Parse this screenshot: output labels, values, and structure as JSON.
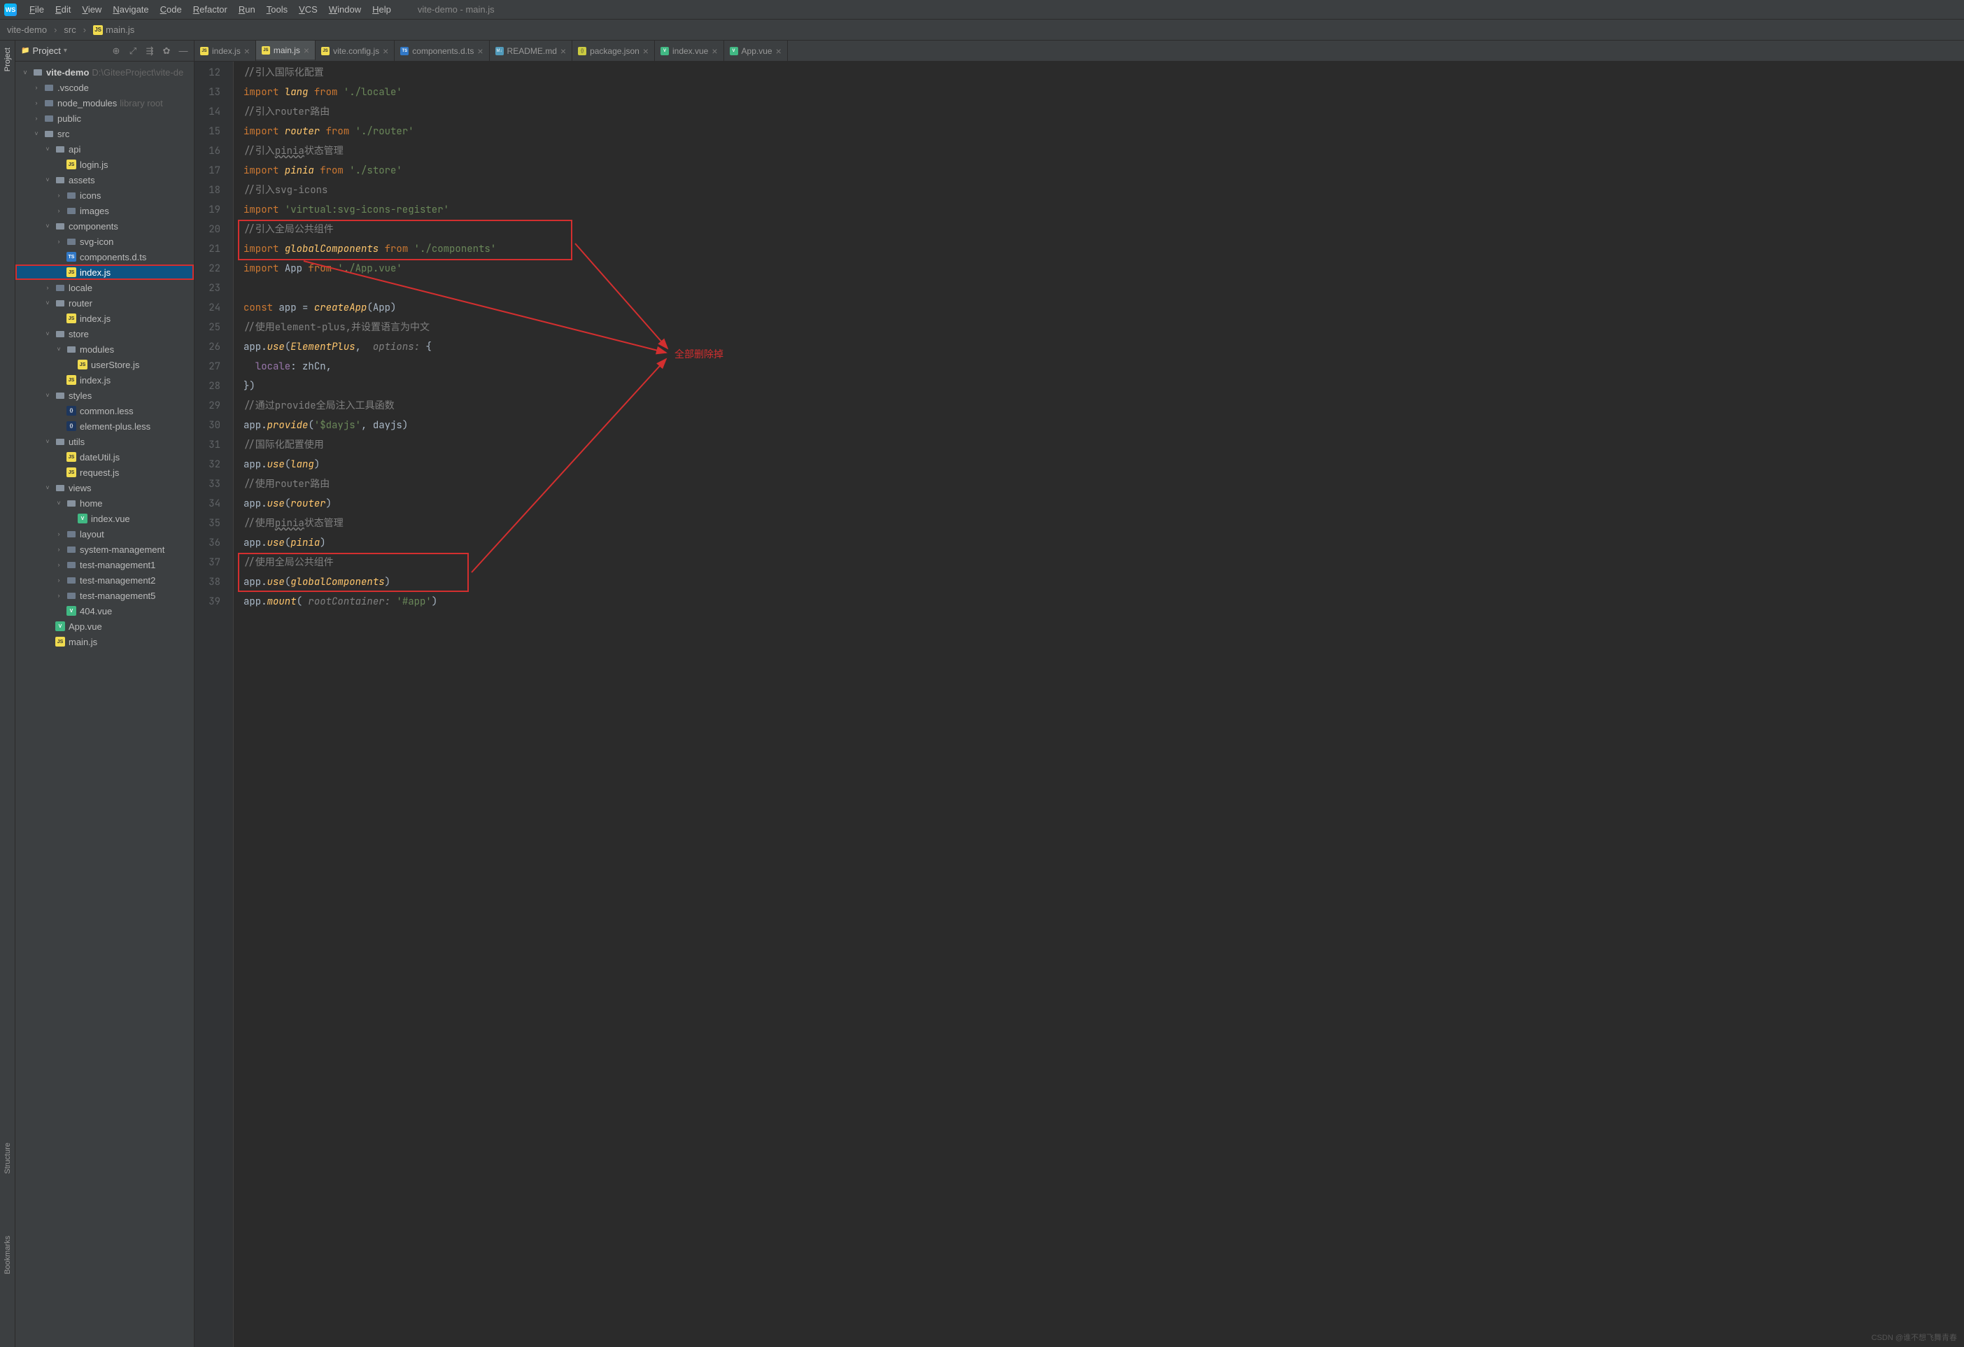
{
  "window": {
    "title": "vite-demo - main.js"
  },
  "menu": {
    "items": [
      "File",
      "Edit",
      "View",
      "Navigate",
      "Code",
      "Refactor",
      "Run",
      "Tools",
      "VCS",
      "Window",
      "Help"
    ]
  },
  "breadcrumb": {
    "root": "vite-demo",
    "mid": "src",
    "file": "main.js"
  },
  "pane": {
    "title": "Project",
    "toolbarIcons": [
      "target",
      "expand",
      "collapse",
      "gear",
      "minimize"
    ]
  },
  "gutterTabs": {
    "project": "Project",
    "structure": "Structure",
    "bookmarks": "Bookmarks"
  },
  "projectTree": {
    "root": {
      "name": "vite-demo",
      "path": "D:\\GiteeProject\\vite-de"
    },
    "items": [
      {
        "name": ".vscode",
        "indent": 1,
        "chev": ">",
        "ico": "folder"
      },
      {
        "name": "node_modules",
        "suffix": "library root",
        "indent": 1,
        "chev": ">",
        "ico": "folder"
      },
      {
        "name": "public",
        "indent": 1,
        "chev": ">",
        "ico": "folder"
      },
      {
        "name": "src",
        "indent": 1,
        "chev": "v",
        "ico": "folder-open"
      },
      {
        "name": "api",
        "indent": 2,
        "chev": "v",
        "ico": "folder-open"
      },
      {
        "name": "login.js",
        "indent": 3,
        "chev": "",
        "ico": "js"
      },
      {
        "name": "assets",
        "indent": 2,
        "chev": "v",
        "ico": "folder-open"
      },
      {
        "name": "icons",
        "indent": 3,
        "chev": ">",
        "ico": "folder"
      },
      {
        "name": "images",
        "indent": 3,
        "chev": ">",
        "ico": "folder"
      },
      {
        "name": "components",
        "indent": 2,
        "chev": "v",
        "ico": "folder-open"
      },
      {
        "name": "svg-icon",
        "indent": 3,
        "chev": ">",
        "ico": "folder"
      },
      {
        "name": "components.d.ts",
        "indent": 3,
        "chev": "",
        "ico": "ts"
      },
      {
        "name": "index.js",
        "indent": 3,
        "chev": "",
        "ico": "js",
        "selected": true
      },
      {
        "name": "locale",
        "indent": 2,
        "chev": ">",
        "ico": "folder"
      },
      {
        "name": "router",
        "indent": 2,
        "chev": "v",
        "ico": "folder-open"
      },
      {
        "name": "index.js",
        "indent": 3,
        "chev": "",
        "ico": "js"
      },
      {
        "name": "store",
        "indent": 2,
        "chev": "v",
        "ico": "folder-open"
      },
      {
        "name": "modules",
        "indent": 3,
        "chev": "v",
        "ico": "folder-open"
      },
      {
        "name": "userStore.js",
        "indent": 4,
        "chev": "",
        "ico": "js"
      },
      {
        "name": "index.js",
        "indent": 3,
        "chev": "",
        "ico": "js"
      },
      {
        "name": "styles",
        "indent": 2,
        "chev": "v",
        "ico": "folder-open"
      },
      {
        "name": "common.less",
        "indent": 3,
        "chev": "",
        "ico": "less"
      },
      {
        "name": "element-plus.less",
        "indent": 3,
        "chev": "",
        "ico": "less"
      },
      {
        "name": "utils",
        "indent": 2,
        "chev": "v",
        "ico": "folder-open"
      },
      {
        "name": "dateUtil.js",
        "indent": 3,
        "chev": "",
        "ico": "js"
      },
      {
        "name": "request.js",
        "indent": 3,
        "chev": "",
        "ico": "js"
      },
      {
        "name": "views",
        "indent": 2,
        "chev": "v",
        "ico": "folder-open"
      },
      {
        "name": "home",
        "indent": 3,
        "chev": "v",
        "ico": "folder-open"
      },
      {
        "name": "index.vue",
        "indent": 4,
        "chev": "",
        "ico": "vue"
      },
      {
        "name": "layout",
        "indent": 3,
        "chev": ">",
        "ico": "folder"
      },
      {
        "name": "system-management",
        "indent": 3,
        "chev": ">",
        "ico": "folder"
      },
      {
        "name": "test-management1",
        "indent": 3,
        "chev": ">",
        "ico": "folder"
      },
      {
        "name": "test-management2",
        "indent": 3,
        "chev": ">",
        "ico": "folder"
      },
      {
        "name": "test-management5",
        "indent": 3,
        "chev": ">",
        "ico": "folder"
      },
      {
        "name": "404.vue",
        "indent": 3,
        "chev": "",
        "ico": "vue"
      },
      {
        "name": "App.vue",
        "indent": 2,
        "chev": "",
        "ico": "vue"
      },
      {
        "name": "main.js",
        "indent": 2,
        "chev": "",
        "ico": "js"
      }
    ]
  },
  "tabs": [
    {
      "label": "index.js",
      "ico": "js"
    },
    {
      "label": "main.js",
      "ico": "js",
      "active": true
    },
    {
      "label": "vite.config.js",
      "ico": "js"
    },
    {
      "label": "components.d.ts",
      "ico": "ts"
    },
    {
      "label": "README.md",
      "ico": "md"
    },
    {
      "label": "package.json",
      "ico": "json"
    },
    {
      "label": "index.vue",
      "ico": "vue"
    },
    {
      "label": "App.vue",
      "ico": "vue"
    }
  ],
  "code": {
    "startLine": 12,
    "lines": [
      {
        "n": 12,
        "tokens": [
          [
            "com",
            "//引入国际化配置"
          ]
        ]
      },
      {
        "n": 13,
        "tokens": [
          [
            "kw",
            "import "
          ],
          [
            "func",
            "lang"
          ],
          [
            "kw",
            " from "
          ],
          [
            "str",
            "'./locale'"
          ]
        ]
      },
      {
        "n": 14,
        "tokens": [
          [
            "com",
            "//引入router路由"
          ]
        ]
      },
      {
        "n": 15,
        "tokens": [
          [
            "kw",
            "import "
          ],
          [
            "func",
            "router"
          ],
          [
            "kw",
            " from "
          ],
          [
            "str",
            "'./router'"
          ]
        ]
      },
      {
        "n": 16,
        "tokens": [
          [
            "com",
            "//引入"
          ],
          [
            "com-ul",
            "pinia"
          ],
          [
            "com",
            "状态管理"
          ]
        ]
      },
      {
        "n": 17,
        "tokens": [
          [
            "kw",
            "import "
          ],
          [
            "func",
            "pinia"
          ],
          [
            "kw",
            " from "
          ],
          [
            "str",
            "'./store'"
          ]
        ]
      },
      {
        "n": 18,
        "tokens": [
          [
            "com",
            "//引入svg-icons"
          ]
        ]
      },
      {
        "n": 19,
        "tokens": [
          [
            "kw",
            "import "
          ],
          [
            "str",
            "'virtual:svg-icons-register'"
          ]
        ]
      },
      {
        "n": 20,
        "tokens": [
          [
            "com",
            "//引入全局公共组件"
          ]
        ]
      },
      {
        "n": 21,
        "tokens": [
          [
            "kw",
            "import "
          ],
          [
            "func",
            "globalComponents"
          ],
          [
            "kw",
            " from "
          ],
          [
            "str",
            "'./components'"
          ]
        ]
      },
      {
        "n": 22,
        "tokens": [
          [
            "kw",
            "import "
          ],
          [
            "ident",
            "App "
          ],
          [
            "kw",
            "from "
          ],
          [
            "str",
            "'./App.vue'"
          ]
        ]
      },
      {
        "n": 23,
        "tokens": [
          [
            "ident",
            ""
          ]
        ]
      },
      {
        "n": 24,
        "tokens": [
          [
            "kw",
            "const "
          ],
          [
            "ident",
            "app = "
          ],
          [
            "func",
            "createApp"
          ],
          [
            "ident",
            "(App)"
          ]
        ]
      },
      {
        "n": 25,
        "tokens": [
          [
            "com",
            "//使用element-plus,并设置语言为中文"
          ]
        ]
      },
      {
        "n": 26,
        "tokens": [
          [
            "ident",
            "app."
          ],
          [
            "func",
            "use"
          ],
          [
            "ident",
            "("
          ],
          [
            "func",
            "ElementPlus"
          ],
          [
            "ident",
            ",  "
          ],
          [
            "param",
            "options:"
          ],
          [
            "ident",
            " {"
          ]
        ]
      },
      {
        "n": 27,
        "tokens": [
          [
            "ident",
            "  "
          ],
          [
            "prop",
            "locale"
          ],
          [
            "ident",
            ": zhCn,"
          ]
        ]
      },
      {
        "n": 28,
        "tokens": [
          [
            "ident",
            "})"
          ]
        ]
      },
      {
        "n": 29,
        "tokens": [
          [
            "com",
            "//通过provide全局注入工具函数"
          ]
        ]
      },
      {
        "n": 30,
        "tokens": [
          [
            "ident",
            "app."
          ],
          [
            "func",
            "provide"
          ],
          [
            "ident",
            "("
          ],
          [
            "str",
            "'$dayjs'"
          ],
          [
            "ident",
            ", dayjs)"
          ]
        ]
      },
      {
        "n": 31,
        "tokens": [
          [
            "com",
            "//国际化配置使用"
          ]
        ]
      },
      {
        "n": 32,
        "tokens": [
          [
            "ident",
            "app."
          ],
          [
            "func",
            "use"
          ],
          [
            "ident",
            "("
          ],
          [
            "func",
            "lang"
          ],
          [
            "ident",
            ")"
          ]
        ]
      },
      {
        "n": 33,
        "tokens": [
          [
            "com",
            "//使用router路由"
          ]
        ]
      },
      {
        "n": 34,
        "tokens": [
          [
            "ident",
            "app."
          ],
          [
            "func",
            "use"
          ],
          [
            "ident",
            "("
          ],
          [
            "func",
            "router"
          ],
          [
            "ident",
            ")"
          ]
        ]
      },
      {
        "n": 35,
        "tokens": [
          [
            "com",
            "//使用"
          ],
          [
            "com-ul",
            "pinia"
          ],
          [
            "com",
            "状态管理"
          ]
        ]
      },
      {
        "n": 36,
        "tokens": [
          [
            "ident",
            "app."
          ],
          [
            "func",
            "use"
          ],
          [
            "ident",
            "("
          ],
          [
            "func",
            "pinia"
          ],
          [
            "ident",
            ")"
          ]
        ]
      },
      {
        "n": 37,
        "tokens": [
          [
            "com",
            "//使用全局公共组件"
          ]
        ]
      },
      {
        "n": 38,
        "tokens": [
          [
            "ident",
            "app."
          ],
          [
            "func",
            "use"
          ],
          [
            "ident",
            "("
          ],
          [
            "func",
            "globalComponents"
          ],
          [
            "ident",
            ")"
          ]
        ]
      },
      {
        "n": 39,
        "tokens": [
          [
            "ident",
            "app."
          ],
          [
            "func",
            "mount"
          ],
          [
            "ident",
            "( "
          ],
          [
            "param",
            "rootContainer:"
          ],
          [
            "ident",
            " "
          ],
          [
            "str",
            "'#app'"
          ],
          [
            "ident",
            ")"
          ]
        ]
      }
    ]
  },
  "annotation": {
    "label": "全部删除掉"
  },
  "watermark": "CSDN @谁不想飞舞青春"
}
